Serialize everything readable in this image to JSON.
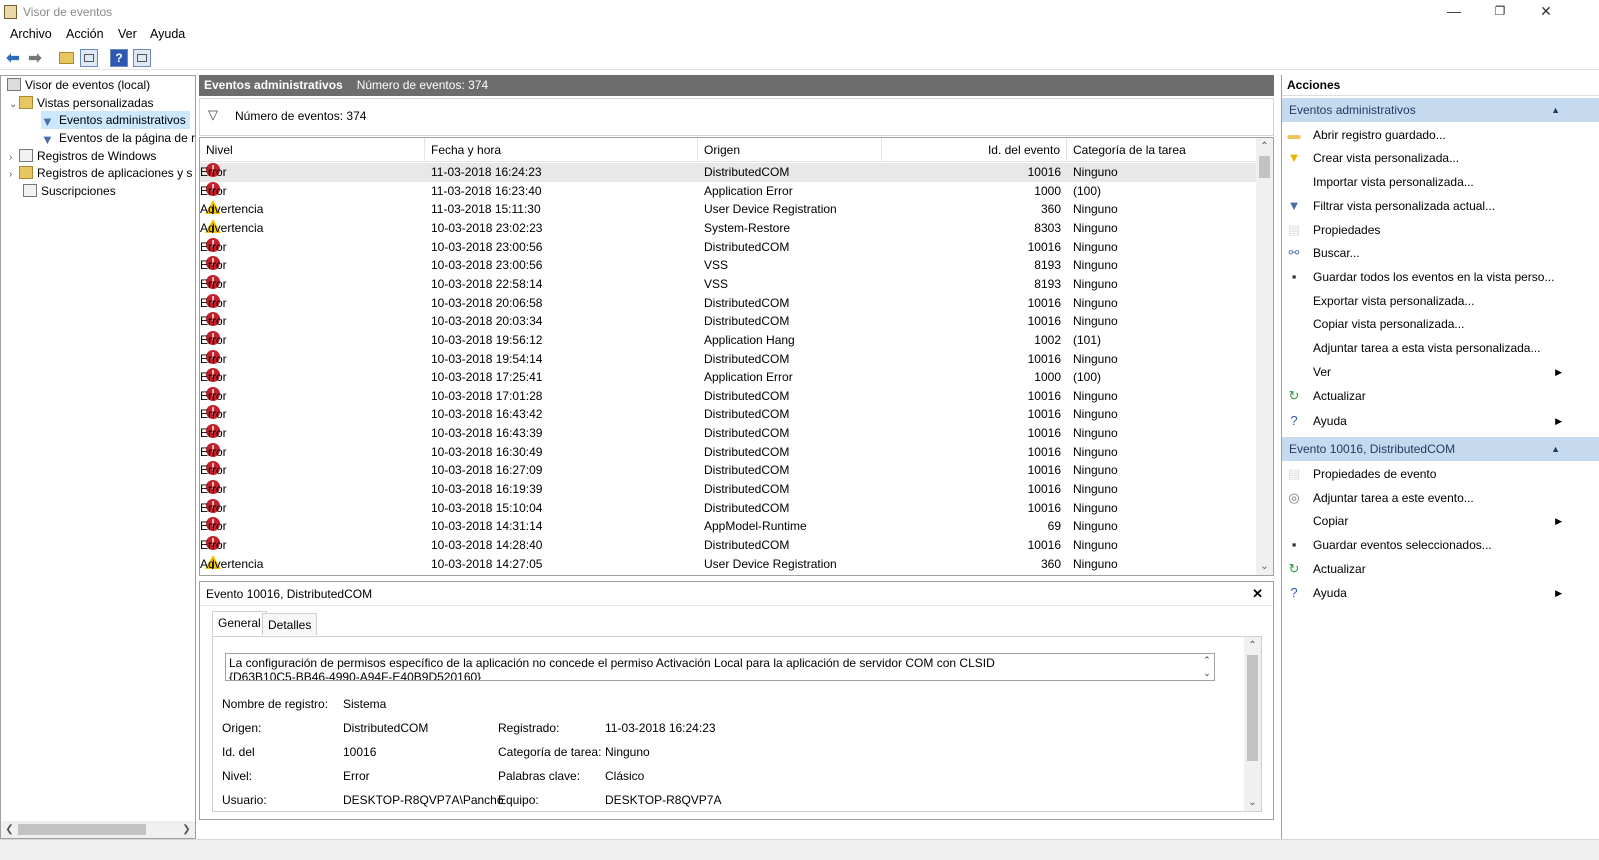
{
  "window": {
    "title": "Visor de eventos",
    "min": "—",
    "max": "❐",
    "close": "✕"
  },
  "menu": [
    "Archivo",
    "Acción",
    "Ver",
    "Ayuda"
  ],
  "tree": {
    "root": "Visor de eventos (local)",
    "custom_views": "Vistas personalizadas",
    "admin_events": "Eventos administrativos",
    "page_events": "Eventos de la página de r",
    "windows_logs": "Registros de Windows",
    "app_logs": "Registros de aplicaciones y s",
    "subscriptions": "Suscripciones"
  },
  "center": {
    "title": "Eventos administrativos",
    "count_header": "Número de eventos: 374",
    "filter_count": "Número de eventos: 374"
  },
  "grid": {
    "columns": [
      "Nivel",
      "Fecha y hora",
      "Origen",
      "Id. del evento",
      "Categoría de la tarea"
    ],
    "rows": [
      {
        "level": "Error",
        "date": "11-03-2018 16:24:23",
        "source": "DistributedCOM",
        "id": "10016",
        "category": "Ninguno"
      },
      {
        "level": "Error",
        "date": "11-03-2018 16:23:40",
        "source": "Application Error",
        "id": "1000",
        "category": "(100)"
      },
      {
        "level": "Advertencia",
        "date": "11-03-2018 15:11:30",
        "source": "User Device Registration",
        "id": "360",
        "category": "Ninguno"
      },
      {
        "level": "Advertencia",
        "date": "10-03-2018 23:02:23",
        "source": "System-Restore",
        "id": "8303",
        "category": "Ninguno"
      },
      {
        "level": "Error",
        "date": "10-03-2018 23:00:56",
        "source": "DistributedCOM",
        "id": "10016",
        "category": "Ninguno"
      },
      {
        "level": "Error",
        "date": "10-03-2018 23:00:56",
        "source": "VSS",
        "id": "8193",
        "category": "Ninguno"
      },
      {
        "level": "Error",
        "date": "10-03-2018 22:58:14",
        "source": "VSS",
        "id": "8193",
        "category": "Ninguno"
      },
      {
        "level": "Error",
        "date": "10-03-2018 20:06:58",
        "source": "DistributedCOM",
        "id": "10016",
        "category": "Ninguno"
      },
      {
        "level": "Error",
        "date": "10-03-2018 20:03:34",
        "source": "DistributedCOM",
        "id": "10016",
        "category": "Ninguno"
      },
      {
        "level": "Error",
        "date": "10-03-2018 19:56:12",
        "source": "Application Hang",
        "id": "1002",
        "category": "(101)"
      },
      {
        "level": "Error",
        "date": "10-03-2018 19:54:14",
        "source": "DistributedCOM",
        "id": "10016",
        "category": "Ninguno"
      },
      {
        "level": "Error",
        "date": "10-03-2018 17:25:41",
        "source": "Application Error",
        "id": "1000",
        "category": "(100)"
      },
      {
        "level": "Error",
        "date": "10-03-2018 17:01:28",
        "source": "DistributedCOM",
        "id": "10016",
        "category": "Ninguno"
      },
      {
        "level": "Error",
        "date": "10-03-2018 16:43:42",
        "source": "DistributedCOM",
        "id": "10016",
        "category": "Ninguno"
      },
      {
        "level": "Error",
        "date": "10-03-2018 16:43:39",
        "source": "DistributedCOM",
        "id": "10016",
        "category": "Ninguno"
      },
      {
        "level": "Error",
        "date": "10-03-2018 16:30:49",
        "source": "DistributedCOM",
        "id": "10016",
        "category": "Ninguno"
      },
      {
        "level": "Error",
        "date": "10-03-2018 16:27:09",
        "source": "DistributedCOM",
        "id": "10016",
        "category": "Ninguno"
      },
      {
        "level": "Error",
        "date": "10-03-2018 16:19:39",
        "source": "DistributedCOM",
        "id": "10016",
        "category": "Ninguno"
      },
      {
        "level": "Error",
        "date": "10-03-2018 15:10:04",
        "source": "DistributedCOM",
        "id": "10016",
        "category": "Ninguno"
      },
      {
        "level": "Error",
        "date": "10-03-2018 14:31:14",
        "source": "AppModel-Runtime",
        "id": "69",
        "category": "Ninguno"
      },
      {
        "level": "Error",
        "date": "10-03-2018 14:28:40",
        "source": "DistributedCOM",
        "id": "10016",
        "category": "Ninguno"
      },
      {
        "level": "Advertencia",
        "date": "10-03-2018 14:27:05",
        "source": "User Device Registration",
        "id": "360",
        "category": "Ninguno"
      }
    ]
  },
  "detail": {
    "title": "Evento 10016, DistributedCOM",
    "tabs": [
      "General",
      "Detalles"
    ],
    "description_line1": "La configuración de permisos específico de la aplicación no concede el permiso Activación Local para la aplicación de servidor COM con CLSID",
    "description_line2": "{D63B10C5-BB46-4990-A94F-E40B9D520160}",
    "fields": {
      "log_name_label": "Nombre de registro:",
      "log_name": "Sistema",
      "source_label": "Origen:",
      "source": "DistributedCOM",
      "logged_label": "Registrado:",
      "logged": "11-03-2018 16:24:23",
      "event_id_label": "Id. del",
      "event_id": "10016",
      "task_label": "Categoría de tarea:",
      "task": "Ninguno",
      "level_label": "Nivel:",
      "level": "Error",
      "keywords_label": "Palabras clave:",
      "keywords": "Clásico",
      "user_label": "Usuario:",
      "user": "DESKTOP-R8QVP7A\\Pancho",
      "computer_label": "Equipo:",
      "computer": "DESKTOP-R8QVP7A"
    }
  },
  "actions": {
    "title": "Acciones",
    "section1": "Eventos administrativos",
    "items1": [
      "Abrir registro guardado...",
      "Crear vista personalizada...",
      "Importar vista personalizada...",
      "Filtrar vista personalizada actual...",
      "Propiedades",
      "Buscar...",
      "Guardar todos los eventos en la vista perso...",
      "Exportar vista personalizada...",
      "Copiar vista personalizada...",
      "Adjuntar tarea a esta vista personalizada...",
      "Ver",
      "Actualizar",
      "Ayuda"
    ],
    "section2": "Evento 10016, DistributedCOM",
    "items2": [
      "Propiedades de evento",
      "Adjuntar tarea a este evento...",
      "Copiar",
      "Guardar eventos seleccionados...",
      "Actualizar",
      "Ayuda"
    ]
  },
  "colors": {
    "header_gray": "#6d6d6d",
    "section_blue": "#c5d9ef",
    "error_red": "#c4202a",
    "warning_yellow": "#f5c400",
    "selection": "#cce8ff"
  }
}
